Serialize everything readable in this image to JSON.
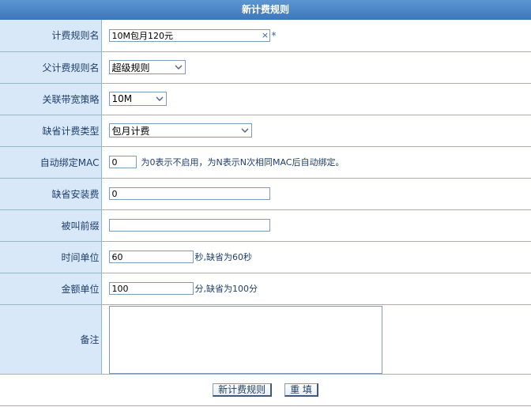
{
  "title": "新计费规则",
  "fields": {
    "rule_name": {
      "label": "计费规则名",
      "value": "10M包月120元",
      "clear": "×",
      "required": "*"
    },
    "parent_rule": {
      "label": "父计费规则名",
      "selected": "超级规则"
    },
    "bandwidth_policy": {
      "label": "关联带宽策略",
      "selected": "10M"
    },
    "billing_type": {
      "label": "缺省计费类型",
      "selected": "包月计费"
    },
    "auto_bind_mac": {
      "label": "自动绑定MAC",
      "value": "0",
      "hint": "为0表示不启用，为N表示N次相同MAC后自动绑定。"
    },
    "install_fee": {
      "label": "缺省安装费",
      "value": "0"
    },
    "called_prefix": {
      "label": "被叫前缀",
      "value": ""
    },
    "time_unit": {
      "label": "时间单位",
      "value": "60",
      "hint": "秒,缺省为60秒"
    },
    "amount_unit": {
      "label": "金额单位",
      "value": "100",
      "hint": "分,缺省为100分"
    },
    "remark": {
      "label": "备注",
      "value": ""
    }
  },
  "buttons": {
    "submit": "新计费规则",
    "reset": "重 填"
  }
}
